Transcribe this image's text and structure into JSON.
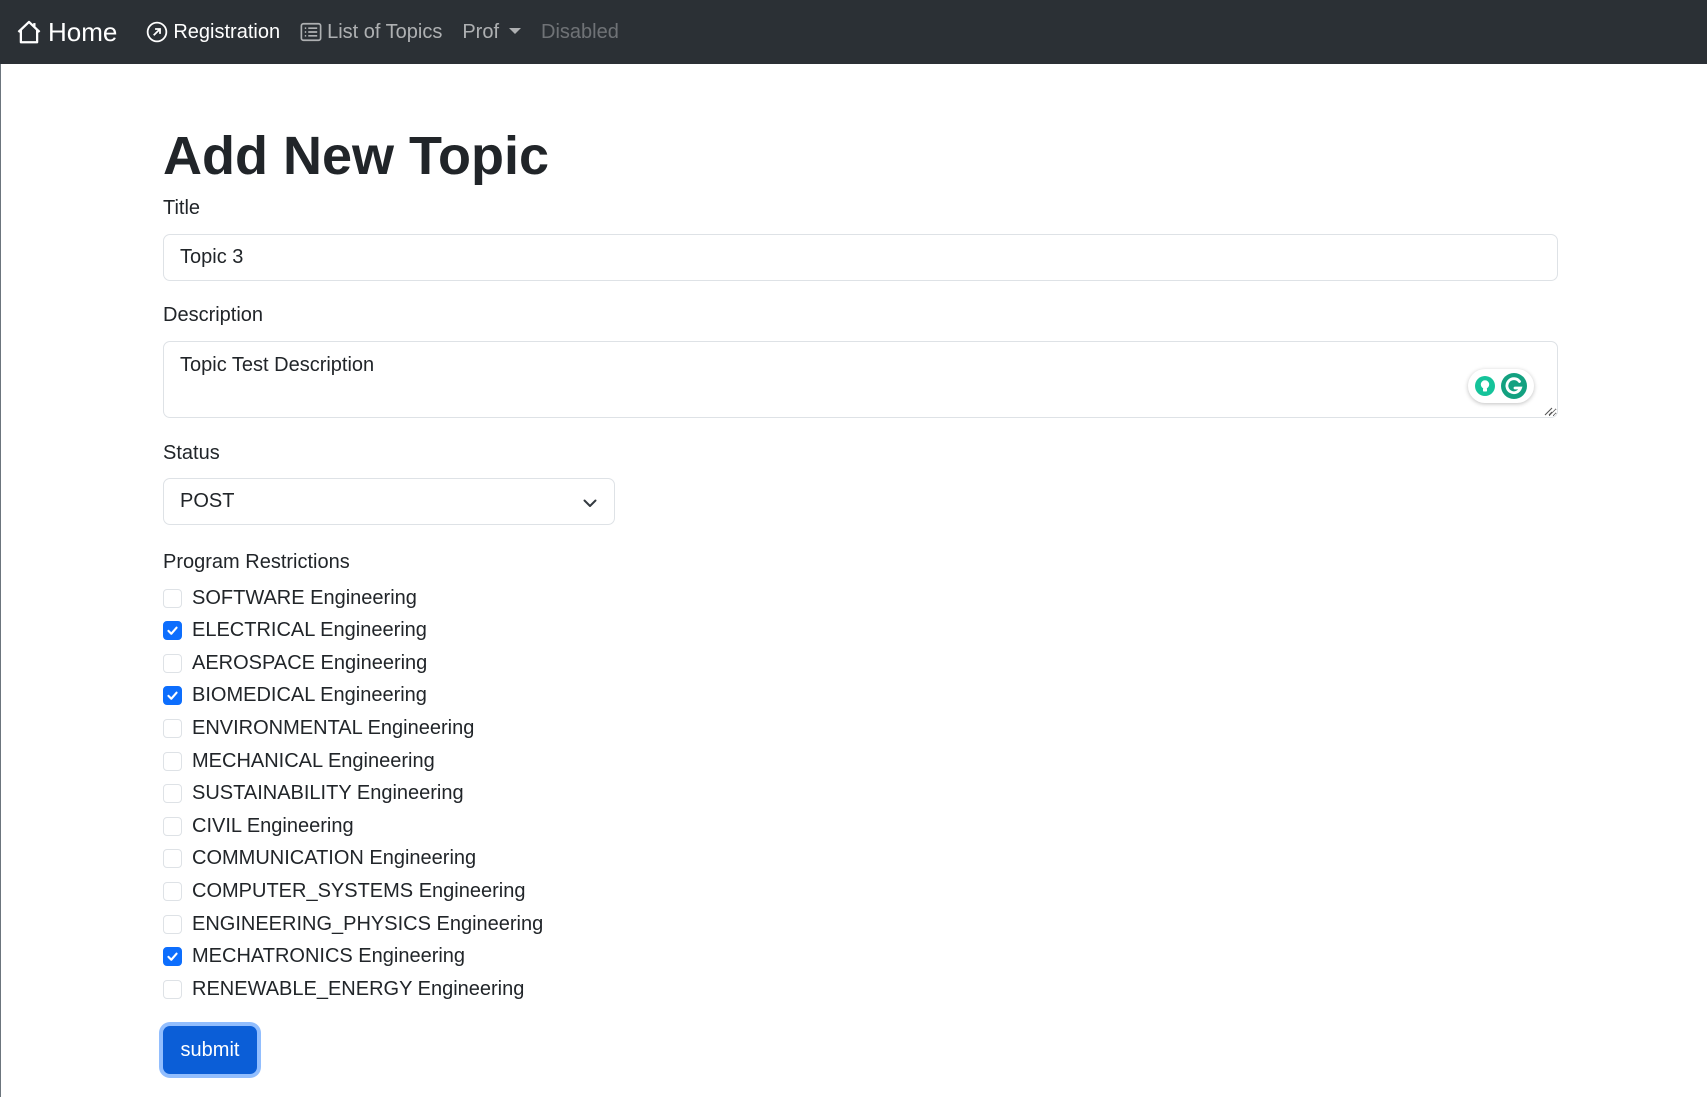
{
  "navbar": {
    "brand_label": "Home",
    "links": [
      {
        "label": "Registration",
        "icon": "arrow-up-right-circle-icon",
        "state": "active"
      },
      {
        "label": "List of Topics",
        "icon": "list-icon",
        "state": "normal"
      },
      {
        "label": "Prof",
        "icon": "caret-down-icon",
        "state": "normal"
      },
      {
        "label": "Disabled",
        "state": "disabled"
      }
    ]
  },
  "page": {
    "title": "Add New Topic"
  },
  "form": {
    "title_label": "Title",
    "title_value": "Topic 3",
    "description_label": "Description",
    "description_value": "Topic Test Description",
    "status_label": "Status",
    "status_value": "POST",
    "programs_label": "Program Restrictions",
    "programs": [
      {
        "label": "SOFTWARE Engineering",
        "checked": false
      },
      {
        "label": "ELECTRICAL Engineering",
        "checked": true
      },
      {
        "label": "AEROSPACE Engineering",
        "checked": false
      },
      {
        "label": "BIOMEDICAL Engineering",
        "checked": true
      },
      {
        "label": "ENVIRONMENTAL Engineering",
        "checked": false
      },
      {
        "label": "MECHANICAL Engineering",
        "checked": false
      },
      {
        "label": "SUSTAINABILITY Engineering",
        "checked": false
      },
      {
        "label": "CIVIL Engineering",
        "checked": false
      },
      {
        "label": "COMMUNICATION Engineering",
        "checked": false
      },
      {
        "label": "COMPUTER_SYSTEMS Engineering",
        "checked": false
      },
      {
        "label": "ENGINEERING_PHYSICS Engineering",
        "checked": false
      },
      {
        "label": "MECHATRONICS Engineering",
        "checked": true
      },
      {
        "label": "RENEWABLE_ENERGY Engineering",
        "checked": false
      }
    ],
    "submit_label": "submit"
  },
  "colors": {
    "navbar_bg": "#2b3035",
    "accent": "#0d6efd",
    "grammarly": "#15c39a"
  }
}
